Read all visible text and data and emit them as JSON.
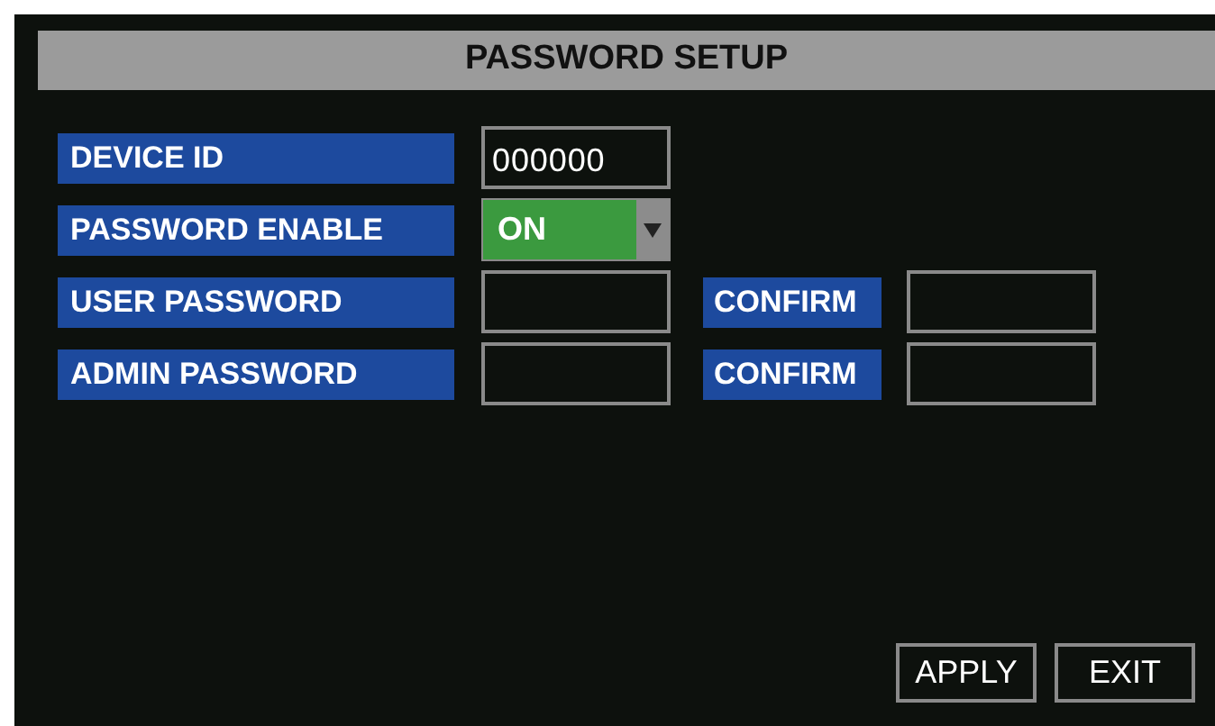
{
  "title": "PASSWORD SETUP",
  "rows": [
    {
      "kind": "field",
      "label": "DEVICE ID",
      "value": "000000"
    },
    {
      "kind": "dropdown",
      "label": "PASSWORD ENABLE",
      "value": "ON"
    },
    {
      "kind": "password",
      "label": "USER PASSWORD",
      "confirm_label": "CONFIRM"
    },
    {
      "kind": "password",
      "label": "ADMIN PASSWORD",
      "confirm_label": "CONFIRM"
    }
  ],
  "buttons": [
    "APPLY",
    "EXIT"
  ]
}
